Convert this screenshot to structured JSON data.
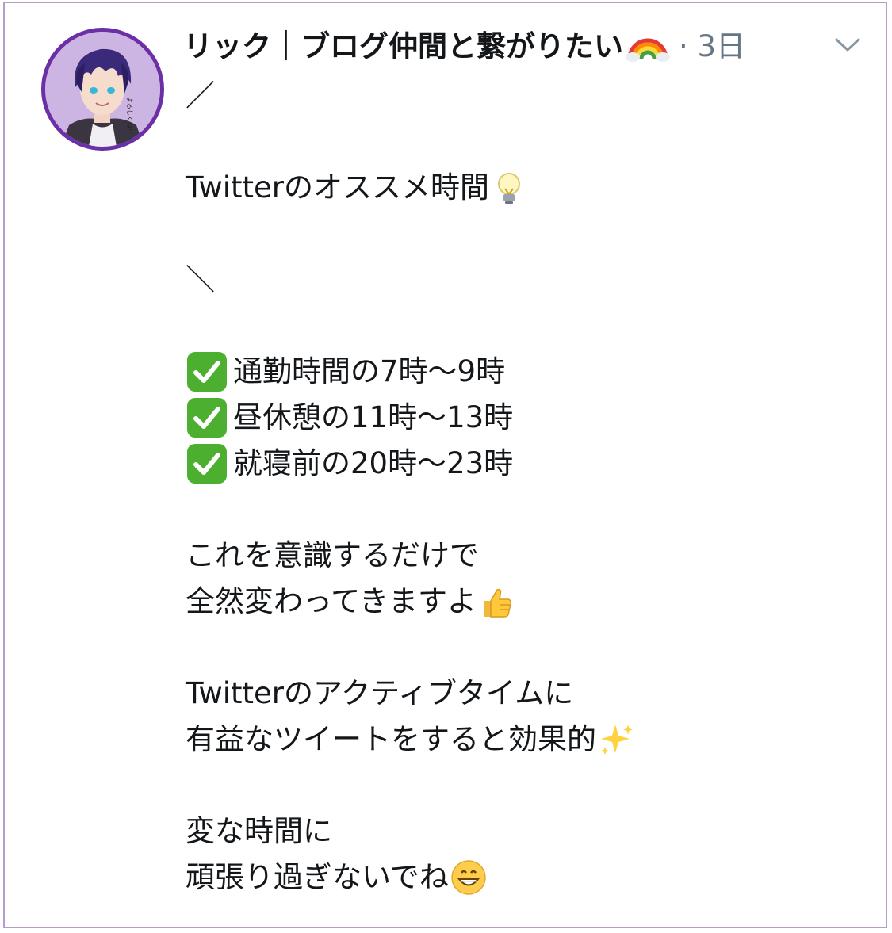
{
  "tweet": {
    "display_name": "リック｜ブログ仲間と繋がりたい",
    "name_emoji": "rainbow-icon",
    "meta": "· 3日",
    "menu_icon": "chevron-down-icon",
    "avatar_caption": "よろしくね!",
    "lines": [
      "／",
      "",
      "Twitterのオススメ時間",
      "",
      "＼",
      "",
      "通勤時間の7時〜9時",
      "昼休憩の11時〜13時",
      "就寝前の20時〜23時",
      "",
      "これを意識するだけで",
      "全然変わってきますよ",
      "",
      "Twitterのアクティブタイムに",
      "有益なツイートをすると効果的",
      "",
      "変な時間に",
      "頑張り過ぎないでね"
    ],
    "emojis": {
      "bulb": "light-bulb-icon",
      "check": "check-mark-button-icon",
      "thumbs": "thumbs-up-icon",
      "sparkles": "sparkles-icon",
      "grin": "grinning-face-icon"
    }
  },
  "colors": {
    "border": "#b79bc8",
    "avatar_ring": "#6b2fa6",
    "text": "#14171a",
    "meta": "#657786",
    "check_green": "#4caf2f"
  }
}
